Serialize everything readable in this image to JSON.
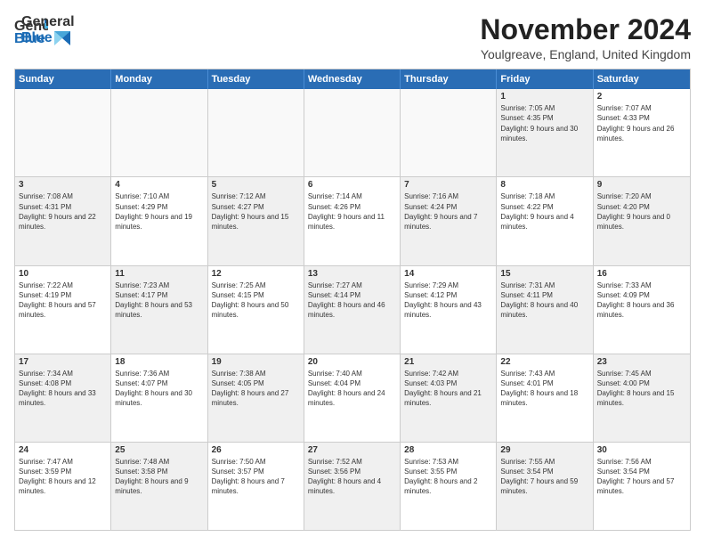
{
  "header": {
    "logo_general": "General",
    "logo_blue": "Blue",
    "title": "November 2024",
    "location": "Youlgreave, England, United Kingdom"
  },
  "days": [
    "Sunday",
    "Monday",
    "Tuesday",
    "Wednesday",
    "Thursday",
    "Friday",
    "Saturday"
  ],
  "weeks": [
    [
      {
        "day": "",
        "info": "",
        "empty": true
      },
      {
        "day": "",
        "info": "",
        "empty": true
      },
      {
        "day": "",
        "info": "",
        "empty": true
      },
      {
        "day": "",
        "info": "",
        "empty": true
      },
      {
        "day": "",
        "info": "",
        "empty": true
      },
      {
        "day": "1",
        "info": "Sunrise: 7:05 AM\nSunset: 4:35 PM\nDaylight: 9 hours and 30 minutes.",
        "shaded": true
      },
      {
        "day": "2",
        "info": "Sunrise: 7:07 AM\nSunset: 4:33 PM\nDaylight: 9 hours and 26 minutes.",
        "shaded": false
      }
    ],
    [
      {
        "day": "3",
        "info": "Sunrise: 7:08 AM\nSunset: 4:31 PM\nDaylight: 9 hours and 22 minutes.",
        "shaded": true
      },
      {
        "day": "4",
        "info": "Sunrise: 7:10 AM\nSunset: 4:29 PM\nDaylight: 9 hours and 19 minutes.",
        "shaded": false
      },
      {
        "day": "5",
        "info": "Sunrise: 7:12 AM\nSunset: 4:27 PM\nDaylight: 9 hours and 15 minutes.",
        "shaded": true
      },
      {
        "day": "6",
        "info": "Sunrise: 7:14 AM\nSunset: 4:26 PM\nDaylight: 9 hours and 11 minutes.",
        "shaded": false
      },
      {
        "day": "7",
        "info": "Sunrise: 7:16 AM\nSunset: 4:24 PM\nDaylight: 9 hours and 7 minutes.",
        "shaded": true
      },
      {
        "day": "8",
        "info": "Sunrise: 7:18 AM\nSunset: 4:22 PM\nDaylight: 9 hours and 4 minutes.",
        "shaded": false
      },
      {
        "day": "9",
        "info": "Sunrise: 7:20 AM\nSunset: 4:20 PM\nDaylight: 9 hours and 0 minutes.",
        "shaded": true
      }
    ],
    [
      {
        "day": "10",
        "info": "Sunrise: 7:22 AM\nSunset: 4:19 PM\nDaylight: 8 hours and 57 minutes.",
        "shaded": false
      },
      {
        "day": "11",
        "info": "Sunrise: 7:23 AM\nSunset: 4:17 PM\nDaylight: 8 hours and 53 minutes.",
        "shaded": true
      },
      {
        "day": "12",
        "info": "Sunrise: 7:25 AM\nSunset: 4:15 PM\nDaylight: 8 hours and 50 minutes.",
        "shaded": false
      },
      {
        "day": "13",
        "info": "Sunrise: 7:27 AM\nSunset: 4:14 PM\nDaylight: 8 hours and 46 minutes.",
        "shaded": true
      },
      {
        "day": "14",
        "info": "Sunrise: 7:29 AM\nSunset: 4:12 PM\nDaylight: 8 hours and 43 minutes.",
        "shaded": false
      },
      {
        "day": "15",
        "info": "Sunrise: 7:31 AM\nSunset: 4:11 PM\nDaylight: 8 hours and 40 minutes.",
        "shaded": true
      },
      {
        "day": "16",
        "info": "Sunrise: 7:33 AM\nSunset: 4:09 PM\nDaylight: 8 hours and 36 minutes.",
        "shaded": false
      }
    ],
    [
      {
        "day": "17",
        "info": "Sunrise: 7:34 AM\nSunset: 4:08 PM\nDaylight: 8 hours and 33 minutes.",
        "shaded": true
      },
      {
        "day": "18",
        "info": "Sunrise: 7:36 AM\nSunset: 4:07 PM\nDaylight: 8 hours and 30 minutes.",
        "shaded": false
      },
      {
        "day": "19",
        "info": "Sunrise: 7:38 AM\nSunset: 4:05 PM\nDaylight: 8 hours and 27 minutes.",
        "shaded": true
      },
      {
        "day": "20",
        "info": "Sunrise: 7:40 AM\nSunset: 4:04 PM\nDaylight: 8 hours and 24 minutes.",
        "shaded": false
      },
      {
        "day": "21",
        "info": "Sunrise: 7:42 AM\nSunset: 4:03 PM\nDaylight: 8 hours and 21 minutes.",
        "shaded": true
      },
      {
        "day": "22",
        "info": "Sunrise: 7:43 AM\nSunset: 4:01 PM\nDaylight: 8 hours and 18 minutes.",
        "shaded": false
      },
      {
        "day": "23",
        "info": "Sunrise: 7:45 AM\nSunset: 4:00 PM\nDaylight: 8 hours and 15 minutes.",
        "shaded": true
      }
    ],
    [
      {
        "day": "24",
        "info": "Sunrise: 7:47 AM\nSunset: 3:59 PM\nDaylight: 8 hours and 12 minutes.",
        "shaded": false
      },
      {
        "day": "25",
        "info": "Sunrise: 7:48 AM\nSunset: 3:58 PM\nDaylight: 8 hours and 9 minutes.",
        "shaded": true
      },
      {
        "day": "26",
        "info": "Sunrise: 7:50 AM\nSunset: 3:57 PM\nDaylight: 8 hours and 7 minutes.",
        "shaded": false
      },
      {
        "day": "27",
        "info": "Sunrise: 7:52 AM\nSunset: 3:56 PM\nDaylight: 8 hours and 4 minutes.",
        "shaded": true
      },
      {
        "day": "28",
        "info": "Sunrise: 7:53 AM\nSunset: 3:55 PM\nDaylight: 8 hours and 2 minutes.",
        "shaded": false
      },
      {
        "day": "29",
        "info": "Sunrise: 7:55 AM\nSunset: 3:54 PM\nDaylight: 7 hours and 59 minutes.",
        "shaded": true
      },
      {
        "day": "30",
        "info": "Sunrise: 7:56 AM\nSunset: 3:54 PM\nDaylight: 7 hours and 57 minutes.",
        "shaded": false
      }
    ]
  ]
}
